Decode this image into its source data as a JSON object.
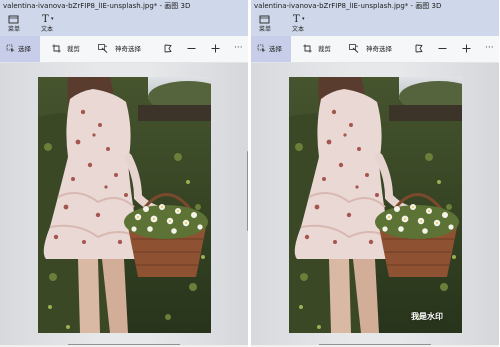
{
  "left_window": {
    "title": "valentina-ivanova-bZrFIP8_lIE-unsplash.jpg* - 画图 3D",
    "menu": {
      "menu_label": "菜单",
      "text_label": "文本"
    },
    "toolbar": {
      "select_label": "选择",
      "crop_label": "裁剪",
      "magic_select_label": "神奇选择"
    }
  },
  "right_window": {
    "title": "valentina-ivanova-bZrFIP8_lIE-unsplash.jpg* - 画图 3D",
    "menu": {
      "menu_label": "菜单",
      "text_label": "文本"
    },
    "toolbar": {
      "select_label": "选择",
      "crop_label": "裁剪",
      "magic_select_label": "神奇选择"
    },
    "watermark": "我是水印"
  },
  "colors": {
    "title_bar": "#cfd8ea",
    "toolbar": "#f6f7f9",
    "active_tool": "#c8cee9",
    "canvas": "#e6e8ea",
    "watermark_text": "#ffffff"
  },
  "icons": [
    "menu-icon",
    "text-icon",
    "select-icon",
    "crop-icon",
    "magic-select-icon",
    "flip-icon",
    "zoom-out-icon",
    "zoom-in-icon",
    "more-icon"
  ]
}
